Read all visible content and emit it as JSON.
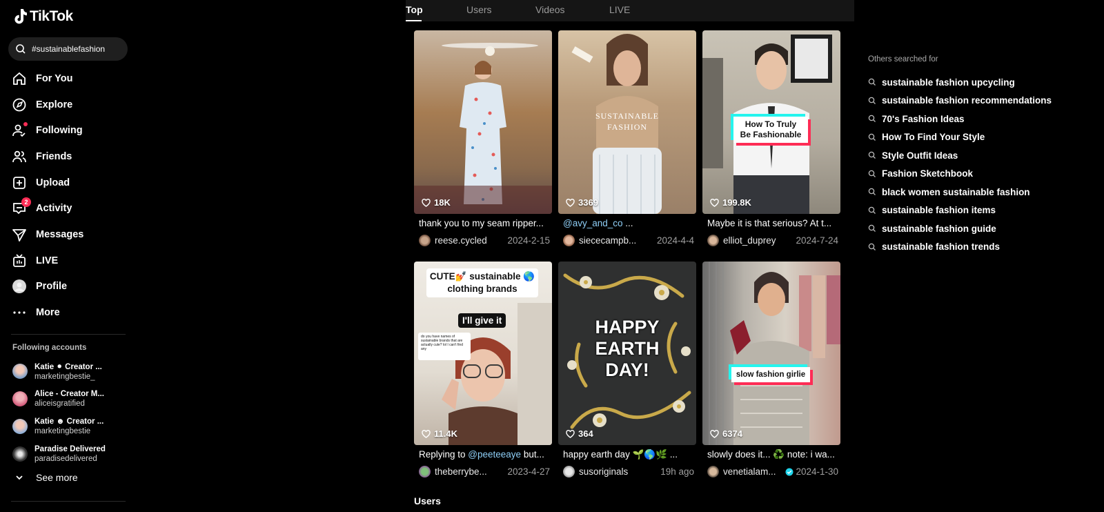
{
  "brand": {
    "name": "TikTok"
  },
  "search": {
    "value": "#sustainablefashion"
  },
  "nav": [
    {
      "label": "For You",
      "icon": "home-icon"
    },
    {
      "label": "Explore",
      "icon": "compass-icon"
    },
    {
      "label": "Following",
      "icon": "following-icon"
    },
    {
      "label": "Friends",
      "icon": "friends-icon"
    },
    {
      "label": "Upload",
      "icon": "upload-icon"
    },
    {
      "label": "Activity",
      "icon": "activity-icon",
      "badge": "2"
    },
    {
      "label": "Messages",
      "icon": "messages-icon"
    },
    {
      "label": "LIVE",
      "icon": "live-icon"
    },
    {
      "label": "Profile",
      "icon": "profile-avatar"
    },
    {
      "label": "More",
      "icon": "more-icon"
    }
  ],
  "following": {
    "title": "Following accounts",
    "accounts": [
      {
        "name": "Katie ⚫ Creator ...",
        "handle": "marketingbestie_"
      },
      {
        "name": "Alice - Creator M...",
        "handle": "aliceisgratified"
      },
      {
        "name": "Katie ☻ Creator ...",
        "handle": "marketingbestie"
      },
      {
        "name": "Paradise Delivered",
        "handle": "paradisedelivered"
      }
    ],
    "see_more": "See more"
  },
  "tabs": [
    "Top",
    "Users",
    "Videos",
    "LIVE"
  ],
  "videos": [
    {
      "likes": "18K",
      "desc": "thank you to my seam ripper...",
      "user": "reese.cycled",
      "date": "2024-2-15"
    },
    {
      "likes": "3369",
      "mention": "@avy_and_co",
      "desc": " ...",
      "overlay": "SUSTAINABLE\nFASHION",
      "user": "siececampb...",
      "date": "2024-4-4"
    },
    {
      "likes": "199.8K",
      "desc": "Maybe it is that serious? At t...",
      "overlay": "How To Truly\nBe Fashionable",
      "user": "elliot_duprey",
      "date": "2024-7-24"
    },
    {
      "likes": "11.4K",
      "desc_prefix": "Replying to ",
      "mention": "@peeteeaye",
      "desc": " but...",
      "overlay": "CUTE💅 sustainable 🌎\nclothing brands",
      "overlay2": "I'll give it",
      "reply_card": "do you have names of sustainable brands that are actually cute? lol I can't find any",
      "user": "theberrybe...",
      "date": "2023-4-27"
    },
    {
      "likes": "364",
      "desc": "happy earth day 🌱🌎🌿 ...",
      "overlay": "HAPPY\nEARTH\nDAY!",
      "user": "susoriginals",
      "date": "19h ago"
    },
    {
      "likes": "6374",
      "desc": "slowly does it... ♻️ note: i wa...",
      "overlay": "slow fashion girlie",
      "user": "venetialam...",
      "date": "2024-1-30"
    }
  ],
  "users_section": "Users",
  "others": {
    "title": "Others searched for",
    "items": [
      "sustainable fashion upcycling",
      "sustainable fashion recommendations",
      "70's Fashion Ideas",
      "How To Find Your Style",
      "Style Outfit Ideas",
      "Fashion Sketchbook",
      "black women sustainable fashion",
      "sustainable fashion items",
      "sustainable fashion guide",
      "sustainable fashion trends"
    ]
  },
  "colors": {
    "accent_red": "#fe2c55",
    "accent_cyan": "#25f4ee",
    "mention": "#8fcff7"
  }
}
